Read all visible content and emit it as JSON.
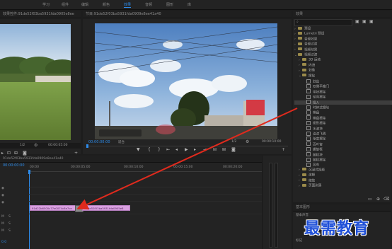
{
  "nav": {
    "items": [
      {
        "label": "学习",
        "active": false
      },
      {
        "label": "组件",
        "active": false
      },
      {
        "label": "编辑",
        "active": false
      },
      {
        "label": "颜色",
        "active": false
      },
      {
        "label": "效果",
        "active": true
      },
      {
        "label": "音频",
        "active": false
      },
      {
        "label": "图形",
        "active": false
      },
      {
        "label": "库",
        "active": false
      }
    ]
  },
  "source_panel": {
    "title": "效果控件:91de52f03ba5931fda0905e8ee",
    "page": "1/2",
    "timecode": "00:00:05:00"
  },
  "program_panel": {
    "title": "节目:91de52f03ba5931fda0909e8ee41a40",
    "timecode_left": "00:00:00:00",
    "fit": "适合",
    "page": "1/2",
    "timecode_right": "00:00:10:00"
  },
  "timeline": {
    "sequence_name": "91de52f03ba5931fda0909e8ee41a40",
    "timecode": "00:00:00:00",
    "ticks": [
      "00:00",
      "00:00:05:00",
      "00:00:10:00",
      "00:00:15:00",
      "00:00:20:00"
    ],
    "tracks": [
      "V3",
      "V2",
      "V1",
      "A1",
      "A2",
      "A3"
    ],
    "clips": [
      {
        "label": "91d22b6500c77e0074c8e7ce"
      },
      {
        "label": "91de52f03ba5931fda0905e8"
      }
    ],
    "transition_label": "⊠"
  },
  "effects_panel": {
    "title": "效果",
    "search_placeholder": "",
    "tree": [
      {
        "label": "预设",
        "type": "folder",
        "indent": 0,
        "expanded": false
      },
      {
        "label": "Lumetri 预设",
        "type": "folder",
        "indent": 0,
        "expanded": false
      },
      {
        "label": "音频效果",
        "type": "folder",
        "indent": 0,
        "expanded": false
      },
      {
        "label": "音频过渡",
        "type": "folder",
        "indent": 0,
        "expanded": false
      },
      {
        "label": "视频效果",
        "type": "folder",
        "indent": 0,
        "expanded": false
      },
      {
        "label": "视频过渡",
        "type": "folder",
        "indent": 0,
        "expanded": true
      },
      {
        "label": "3D 运动",
        "type": "folder",
        "indent": 1,
        "expanded": false
      },
      {
        "label": "内滑",
        "type": "folder",
        "indent": 1,
        "expanded": false
      },
      {
        "label": "划像",
        "type": "folder",
        "indent": 1,
        "expanded": false
      },
      {
        "label": "擦除",
        "type": "folder",
        "indent": 1,
        "expanded": true
      },
      {
        "label": "划出",
        "type": "fx",
        "indent": 2,
        "selected": false
      },
      {
        "label": "双侧平推门",
        "type": "fx",
        "indent": 2,
        "selected": false
      },
      {
        "label": "带状擦除",
        "type": "fx",
        "indent": 2,
        "selected": false
      },
      {
        "label": "径向擦除",
        "type": "fx",
        "indent": 2,
        "selected": false
      },
      {
        "label": "插入",
        "type": "fx",
        "indent": 2,
        "selected": true
      },
      {
        "label": "时钟式擦除",
        "type": "fx",
        "indent": 2,
        "selected": false
      },
      {
        "label": "棋盘",
        "type": "fx",
        "indent": 2,
        "selected": false
      },
      {
        "label": "棋盘擦除",
        "type": "fx",
        "indent": 2,
        "selected": false
      },
      {
        "label": "楔形擦除",
        "type": "fx",
        "indent": 2,
        "selected": false
      },
      {
        "label": "水波块",
        "type": "fx",
        "indent": 2,
        "selected": false
      },
      {
        "label": "油漆飞溅",
        "type": "fx",
        "indent": 2,
        "selected": false
      },
      {
        "label": "渐变擦除",
        "type": "fx",
        "indent": 2,
        "selected": false
      },
      {
        "label": "百叶窗",
        "type": "fx",
        "indent": 2,
        "selected": false
      },
      {
        "label": "螺旋框",
        "type": "fx",
        "indent": 2,
        "selected": false
      },
      {
        "label": "随机块",
        "type": "fx",
        "indent": 2,
        "selected": false
      },
      {
        "label": "随机擦除",
        "type": "fx",
        "indent": 2,
        "selected": false
      },
      {
        "label": "风车",
        "type": "fx",
        "indent": 2,
        "selected": false
      },
      {
        "label": "沉浸式视频",
        "type": "folder",
        "indent": 1,
        "expanded": false
      },
      {
        "label": "溶解",
        "type": "folder",
        "indent": 1,
        "expanded": false
      },
      {
        "label": "缩放",
        "type": "folder",
        "indent": 1,
        "expanded": false
      },
      {
        "label": "页面剥落",
        "type": "folder",
        "indent": 1,
        "expanded": false
      }
    ]
  },
  "essential_panel": {
    "title": "基本图形",
    "tab": "基本声音",
    "label": "标记"
  },
  "watermark": "最需教育",
  "colors": {
    "accent": "#2d8ceb",
    "clip": "#d9a0e0",
    "arrow": "#e02a1d",
    "watermark": "#1e4fd8"
  }
}
